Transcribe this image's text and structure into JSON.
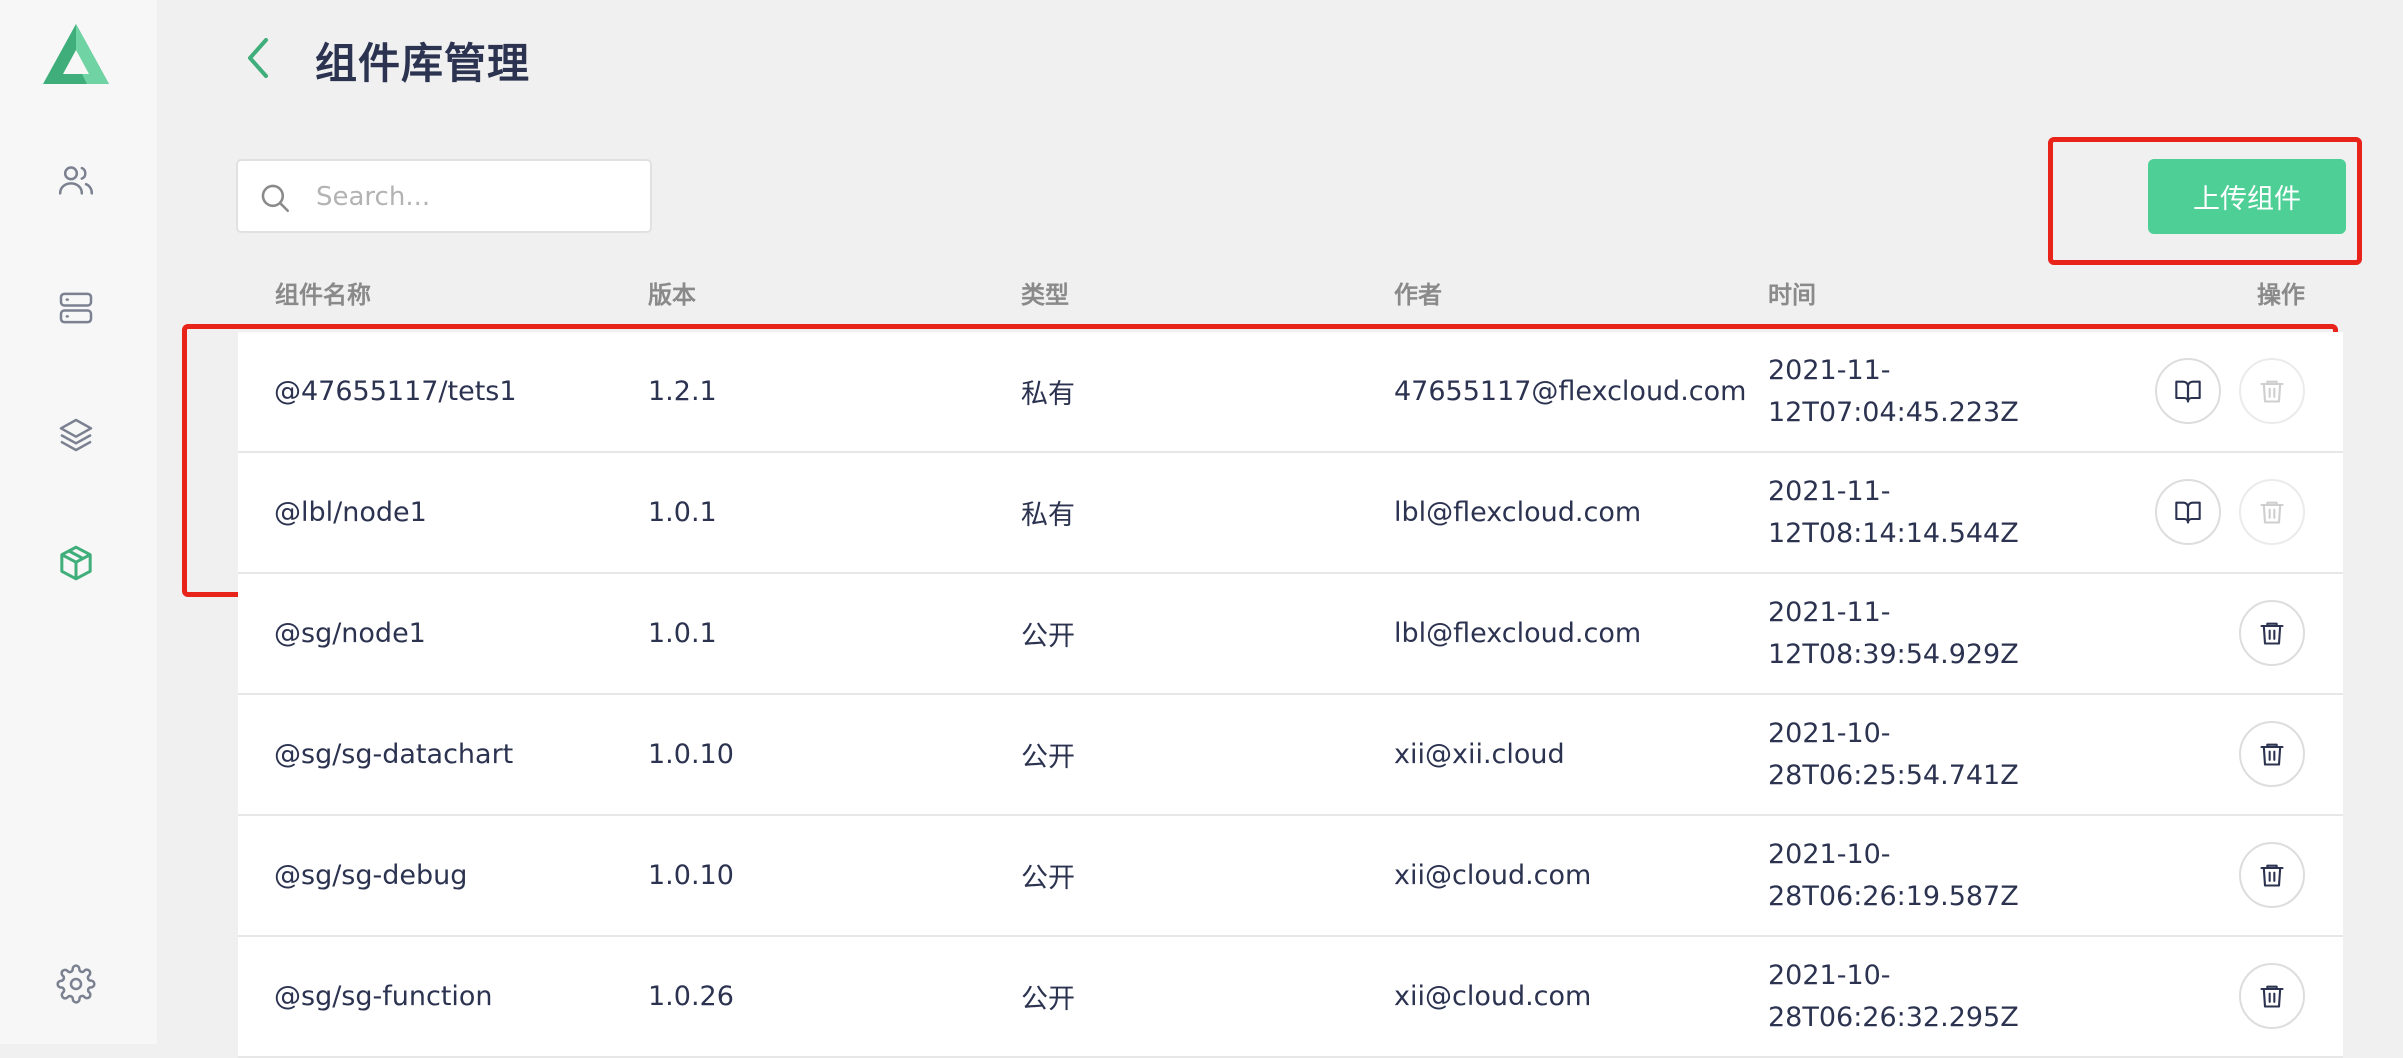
{
  "app": {
    "page_title": "组件库管理"
  },
  "colors": {
    "accent": "#4ecf96",
    "highlight": "#e8231a",
    "text": "#2c3350"
  },
  "sidebar": {
    "items": [
      {
        "icon": "users-icon"
      },
      {
        "icon": "server-icon"
      },
      {
        "icon": "layers-icon"
      },
      {
        "icon": "package-icon",
        "active": true
      },
      {
        "icon": "gear-icon"
      }
    ]
  },
  "search": {
    "placeholder": "Search...",
    "value": ""
  },
  "toolbar": {
    "upload_label": "上传组件"
  },
  "table": {
    "columns": [
      "组件名称",
      "版本",
      "类型",
      "作者",
      "时间",
      "操作"
    ],
    "rows": [
      {
        "name": "@47655117/tets1",
        "version": "1.2.1",
        "type": "私有",
        "author": "47655117@flexcloud.com",
        "time_date": "2021-11-",
        "time_rest": "12T07:04:45.223Z",
        "has_doc": true,
        "delete_disabled": true
      },
      {
        "name": "@lbl/node1",
        "version": "1.0.1",
        "type": "私有",
        "author": "lbl@flexcloud.com",
        "time_date": "2021-11-",
        "time_rest": "12T08:14:14.544Z",
        "has_doc": true,
        "delete_disabled": true
      },
      {
        "name": "@sg/node1",
        "version": "1.0.1",
        "type": "公开",
        "author": "lbl@flexcloud.com",
        "time_date": "2021-11-",
        "time_rest": "12T08:39:54.929Z",
        "has_doc": false,
        "delete_disabled": false
      },
      {
        "name": "@sg/sg-datachart",
        "version": "1.0.10",
        "type": "公开",
        "author": "xii@xii.cloud",
        "time_date": "2021-10-",
        "time_rest": "28T06:25:54.741Z",
        "has_doc": false,
        "delete_disabled": false
      },
      {
        "name": "@sg/sg-debug",
        "version": "1.0.10",
        "type": "公开",
        "author": "xii@cloud.com",
        "time_date": "2021-10-",
        "time_rest": "28T06:26:19.587Z",
        "has_doc": false,
        "delete_disabled": false
      },
      {
        "name": "@sg/sg-function",
        "version": "1.0.26",
        "type": "公开",
        "author": "xii@cloud.com",
        "time_date": "2021-10-",
        "time_rest": "28T06:26:32.295Z",
        "has_doc": false,
        "delete_disabled": false
      }
    ]
  }
}
